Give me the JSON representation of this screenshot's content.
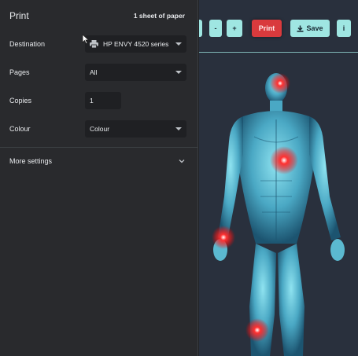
{
  "dialog": {
    "title": "Print",
    "sheet_count": "1 sheet of paper",
    "destination": {
      "label": "Destination",
      "value": "HP ENVY 4520 series"
    },
    "pages": {
      "label": "Pages",
      "value": "All"
    },
    "copies": {
      "label": "Copies",
      "value": "1"
    },
    "colour": {
      "label": "Colour",
      "value": "Colour"
    },
    "more_settings": "More settings"
  },
  "toolbar": {
    "minus_label": "-",
    "plus_label": "+",
    "print_label": "Print",
    "save_label": "Save",
    "info_label": "i"
  },
  "colors": {
    "panel_bg": "#292a2d",
    "preview_bg": "#29303d",
    "accent_teal": "#9fe6e2",
    "print_red": "#d93a3d",
    "hotspot_red": "#ff2a2a"
  }
}
